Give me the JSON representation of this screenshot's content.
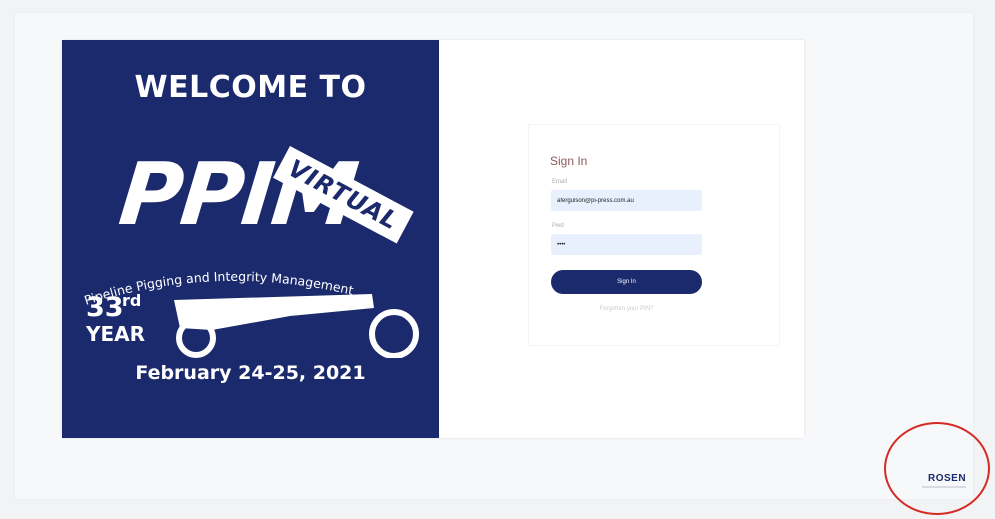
{
  "banner": {
    "heading": "WELCOME TO",
    "logo_text": "PPIM",
    "virtual_label": "VIRTUAL",
    "subtitle": "Pipeline Pigging and Integrity Management",
    "year_number": "33",
    "year_suffix": "rd",
    "year_word": "YEAR",
    "dates": "February 24-25, 2021",
    "background_color": "#1a2a6c"
  },
  "signin": {
    "title": "Sign In",
    "email_label": "Email",
    "email_value": "afergulson@pi-press.com.au",
    "password_label": "Pwd",
    "password_value": "••••",
    "button_label": "Sign In",
    "forgot_link": "Forgotten your PIN?"
  },
  "footer": {
    "sponsor_logo": "ROSEN"
  },
  "colors": {
    "accent": "#1a2a6c",
    "highlight_circle": "#d42b25",
    "input_bg": "#e8f0fe"
  }
}
